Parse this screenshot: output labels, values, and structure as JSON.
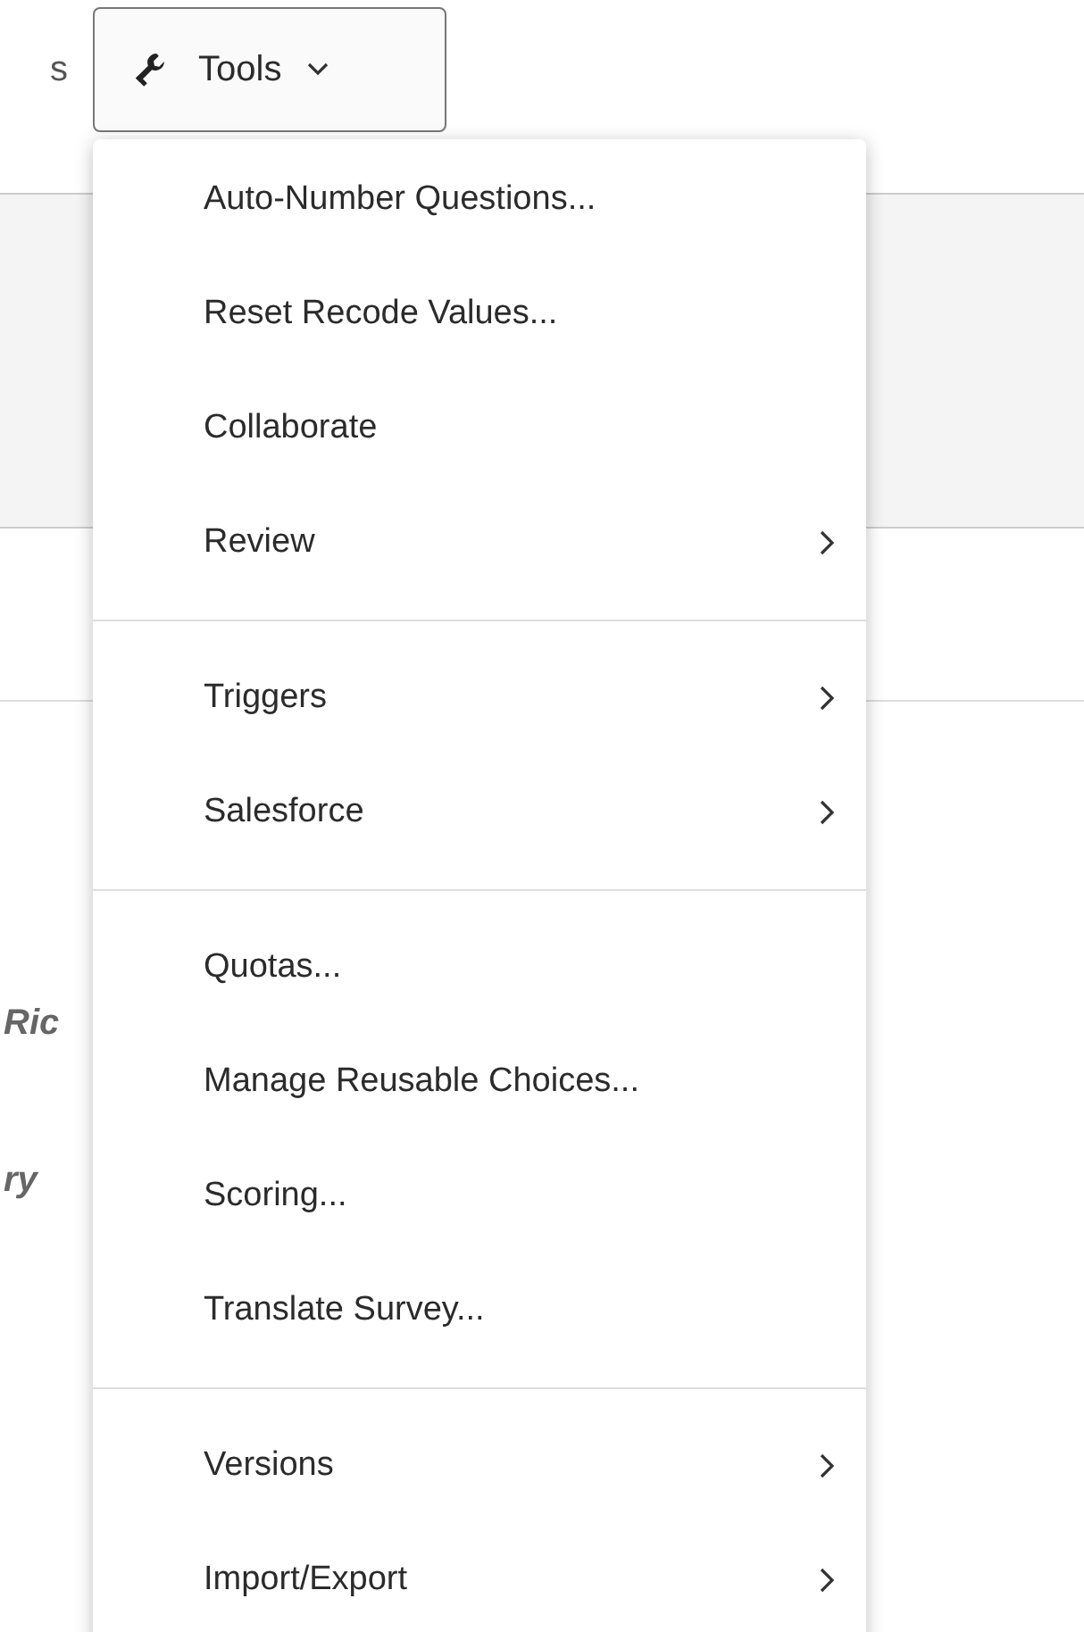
{
  "nav_partial_text": "s",
  "tools_button": {
    "label": "Tools",
    "expanded": true
  },
  "background_texts": [
    "Ric",
    "ry"
  ],
  "menu_groups": [
    {
      "items": [
        {
          "label": "Auto-Number Questions...",
          "submenu": false
        },
        {
          "label": "Reset Recode Values...",
          "submenu": false
        },
        {
          "label": "Collaborate",
          "submenu": false
        },
        {
          "label": "Review",
          "submenu": true
        }
      ]
    },
    {
      "items": [
        {
          "label": "Triggers",
          "submenu": true
        },
        {
          "label": "Salesforce",
          "submenu": true
        }
      ]
    },
    {
      "items": [
        {
          "label": "Quotas...",
          "submenu": false
        },
        {
          "label": "Manage Reusable Choices...",
          "submenu": false
        },
        {
          "label": "Scoring...",
          "submenu": false
        },
        {
          "label": "Translate Survey...",
          "submenu": false
        }
      ]
    },
    {
      "items": [
        {
          "label": "Versions",
          "submenu": true
        },
        {
          "label": "Import/Export",
          "submenu": true
        }
      ]
    }
  ]
}
